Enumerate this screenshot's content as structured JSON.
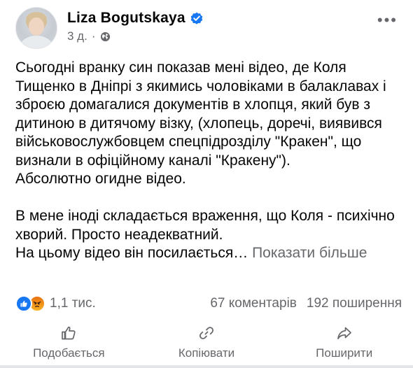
{
  "author": {
    "name": "Liza Bogutskaya",
    "verified": true,
    "verified_color": "#1877f2"
  },
  "post": {
    "time": "3 д.",
    "separator": "·",
    "audience_icon": "globe-icon",
    "paragraph_1": "Сьогодні вранку син показав мені відео, де Коля Тищенко в Дніпрі з якимись чоловіками в балаклавах і зброєю домагалися документів в хлопця, який був з дитиною в дитячому візку, (хлопець, доречі, виявився військовослужбовцем спецпідрозділу \"Кракен\", що визнали в офіційному каналі \"Кракену\").",
    "paragraph_2": "Абсолютно огидне відео.",
    "paragraph_3": "В мене іноді складається враження, що Коля - психічно хворий. Просто неадекватний.",
    "paragraph_4": "На цьому відео він посилається…",
    "see_more": "Показати більше"
  },
  "stats": {
    "reactions": [
      "like",
      "angry"
    ],
    "reactions_count": "1,1 тис.",
    "comments": "67 коментарів",
    "shares": "192 поширення"
  },
  "actions": {
    "like_label": "Подобається",
    "copy_label": "Копіювати",
    "share_label": "Поширити"
  },
  "colors": {
    "text": "#050505",
    "secondary": "#65676b",
    "accent": "#1877f2",
    "angry": "#f7b125"
  }
}
